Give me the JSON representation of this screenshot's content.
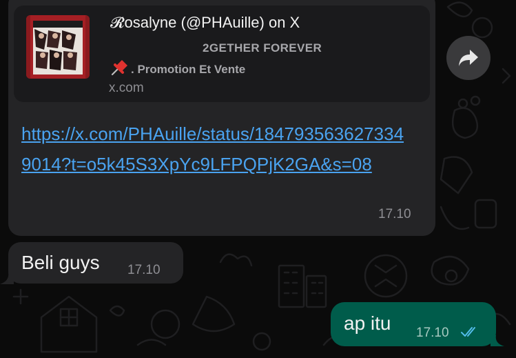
{
  "link_message": {
    "preview": {
      "title": "𝓡osalyne (@PHAuille) on X",
      "description_line1": "2GETHER FOREVER",
      "description_line2": ". Promotion Et Vente",
      "domain": "x.com"
    },
    "url": "https://x.com/PHAuille/status/1847935636273349014?t=o5k45S3XpYc9LFPQPjK2GA&s=08",
    "time": "17.10"
  },
  "incoming_message": {
    "text": "Beli guys",
    "time": "17.10"
  },
  "outgoing_message": {
    "text": "ap itu",
    "time": "17.10",
    "status": "read"
  },
  "icons": {
    "share": "forward-arrow-icon",
    "read_receipt": "double-check-icon",
    "pin": "pushpin-icon"
  },
  "colors": {
    "incoming_bubble": "#242426",
    "outgoing_bubble": "#005c4b",
    "link": "#4aa3f0",
    "background": "#0b0b0b"
  }
}
